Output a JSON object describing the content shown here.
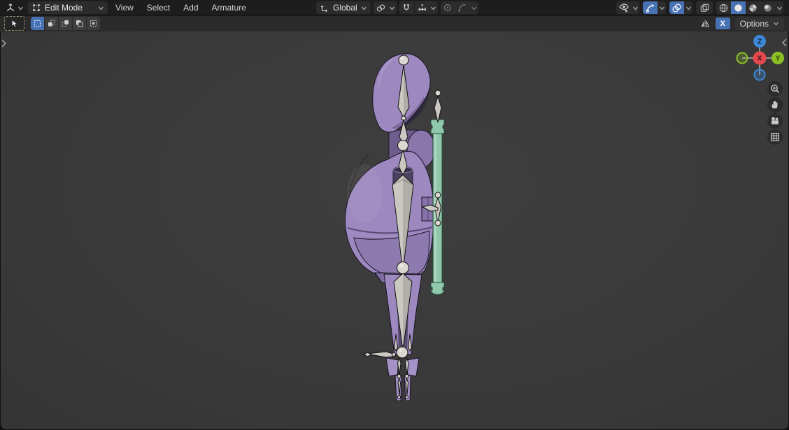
{
  "header": {
    "mode_label": "Edit Mode",
    "menus": [
      "View",
      "Select",
      "Add",
      "Armature"
    ],
    "orientation_label": "Global",
    "icons": [
      "editor-3d-viewport-icon",
      "edit-mode-icon",
      "orientation-global-icon",
      "pivot-point-icon",
      "snap-magnet-icon",
      "snap-increment-icon",
      "proportional-edit-icon",
      "falloff-curve-icon",
      "object-visibility-icon",
      "gizmos-icon",
      "overlays-icon",
      "xray-icon",
      "shading-wireframe-icon",
      "shading-solid-icon",
      "shading-material-icon",
      "shading-rendered-icon"
    ]
  },
  "tool_settings": {
    "x_mirror_label": "X",
    "options_label": "Options",
    "icons": [
      "tweak-tool-icon",
      "select-set-icon",
      "select-extend-icon",
      "select-subtract-icon",
      "select-invert-icon",
      "select-intersect-icon",
      "mirror-icon"
    ]
  },
  "viewport": {
    "gizmo": {
      "x": "X",
      "y": "Y",
      "z": "Z"
    },
    "side_icons": [
      "zoom-icon",
      "pan-hand-icon",
      "camera-icon",
      "ortho-grid-icon"
    ],
    "scene_objects": [
      "character-mesh",
      "armature-bones",
      "staff-mesh"
    ]
  },
  "colors": {
    "accent": "#4772b3",
    "header_bg": "#1d1d1d",
    "toolbar_bg": "#2b2b2b",
    "viewport_bg": "#3a3a3a",
    "body": "#9d89bf",
    "body_shadow": "#8d7aae",
    "body_deep": "#574b70",
    "bone": "#cbc8c2",
    "joint": "#dad7d1",
    "staff": "#8fc8aa",
    "axis_x": "#e5484d",
    "axis_y": "#8bc024",
    "axis_z": "#3d87d6"
  }
}
